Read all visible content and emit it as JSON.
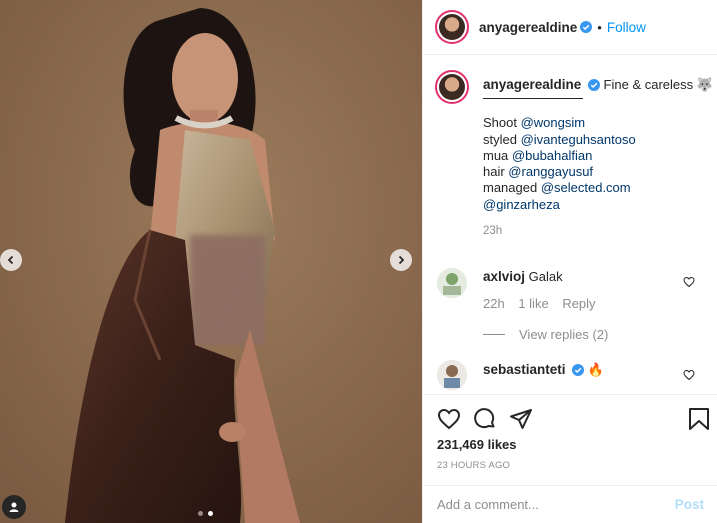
{
  "post": {
    "author": "anyagerealdine",
    "follow_label": "Follow",
    "separator": "•",
    "carousel": {
      "total_slides": 2,
      "active_slide": 2
    }
  },
  "caption": {
    "username": "anyagerealdine",
    "title": "Fine & careless 🐺",
    "lines": [
      {
        "label": "Shoot ",
        "mention": "@wongsim"
      },
      {
        "label": "styled ",
        "mention": "@ivanteguhsantoso"
      },
      {
        "label": "mua ",
        "mention": "@bubahalfian"
      },
      {
        "label": "hair ",
        "mention": "@ranggayusuf"
      },
      {
        "label": "managed ",
        "mention": "@selected.com"
      },
      {
        "label": "",
        "mention": "@ginzarheza"
      }
    ],
    "time": "23h"
  },
  "comments": [
    {
      "username": "axlvioj",
      "text": "Galak",
      "time": "22h",
      "likes": "1 like",
      "reply": "Reply",
      "view_replies": "View replies (2)"
    },
    {
      "username": "sebastianteti",
      "text": "🔥",
      "verified": true
    }
  ],
  "stats": {
    "likes": "231,469 likes",
    "posted": "23 HOURS AGO"
  },
  "composer": {
    "placeholder": "Add a comment...",
    "post_label": "Post"
  },
  "colors": {
    "accent": "#0095f6",
    "verified": "#3897f0",
    "photo_bg": "#8a6a4e",
    "post_disabled": "#b2dffc"
  },
  "icons": [
    "chevron-left-icon",
    "chevron-right-icon",
    "user-tag-icon",
    "verified-icon",
    "heart-icon",
    "comment-icon",
    "share-icon",
    "bookmark-icon"
  ]
}
